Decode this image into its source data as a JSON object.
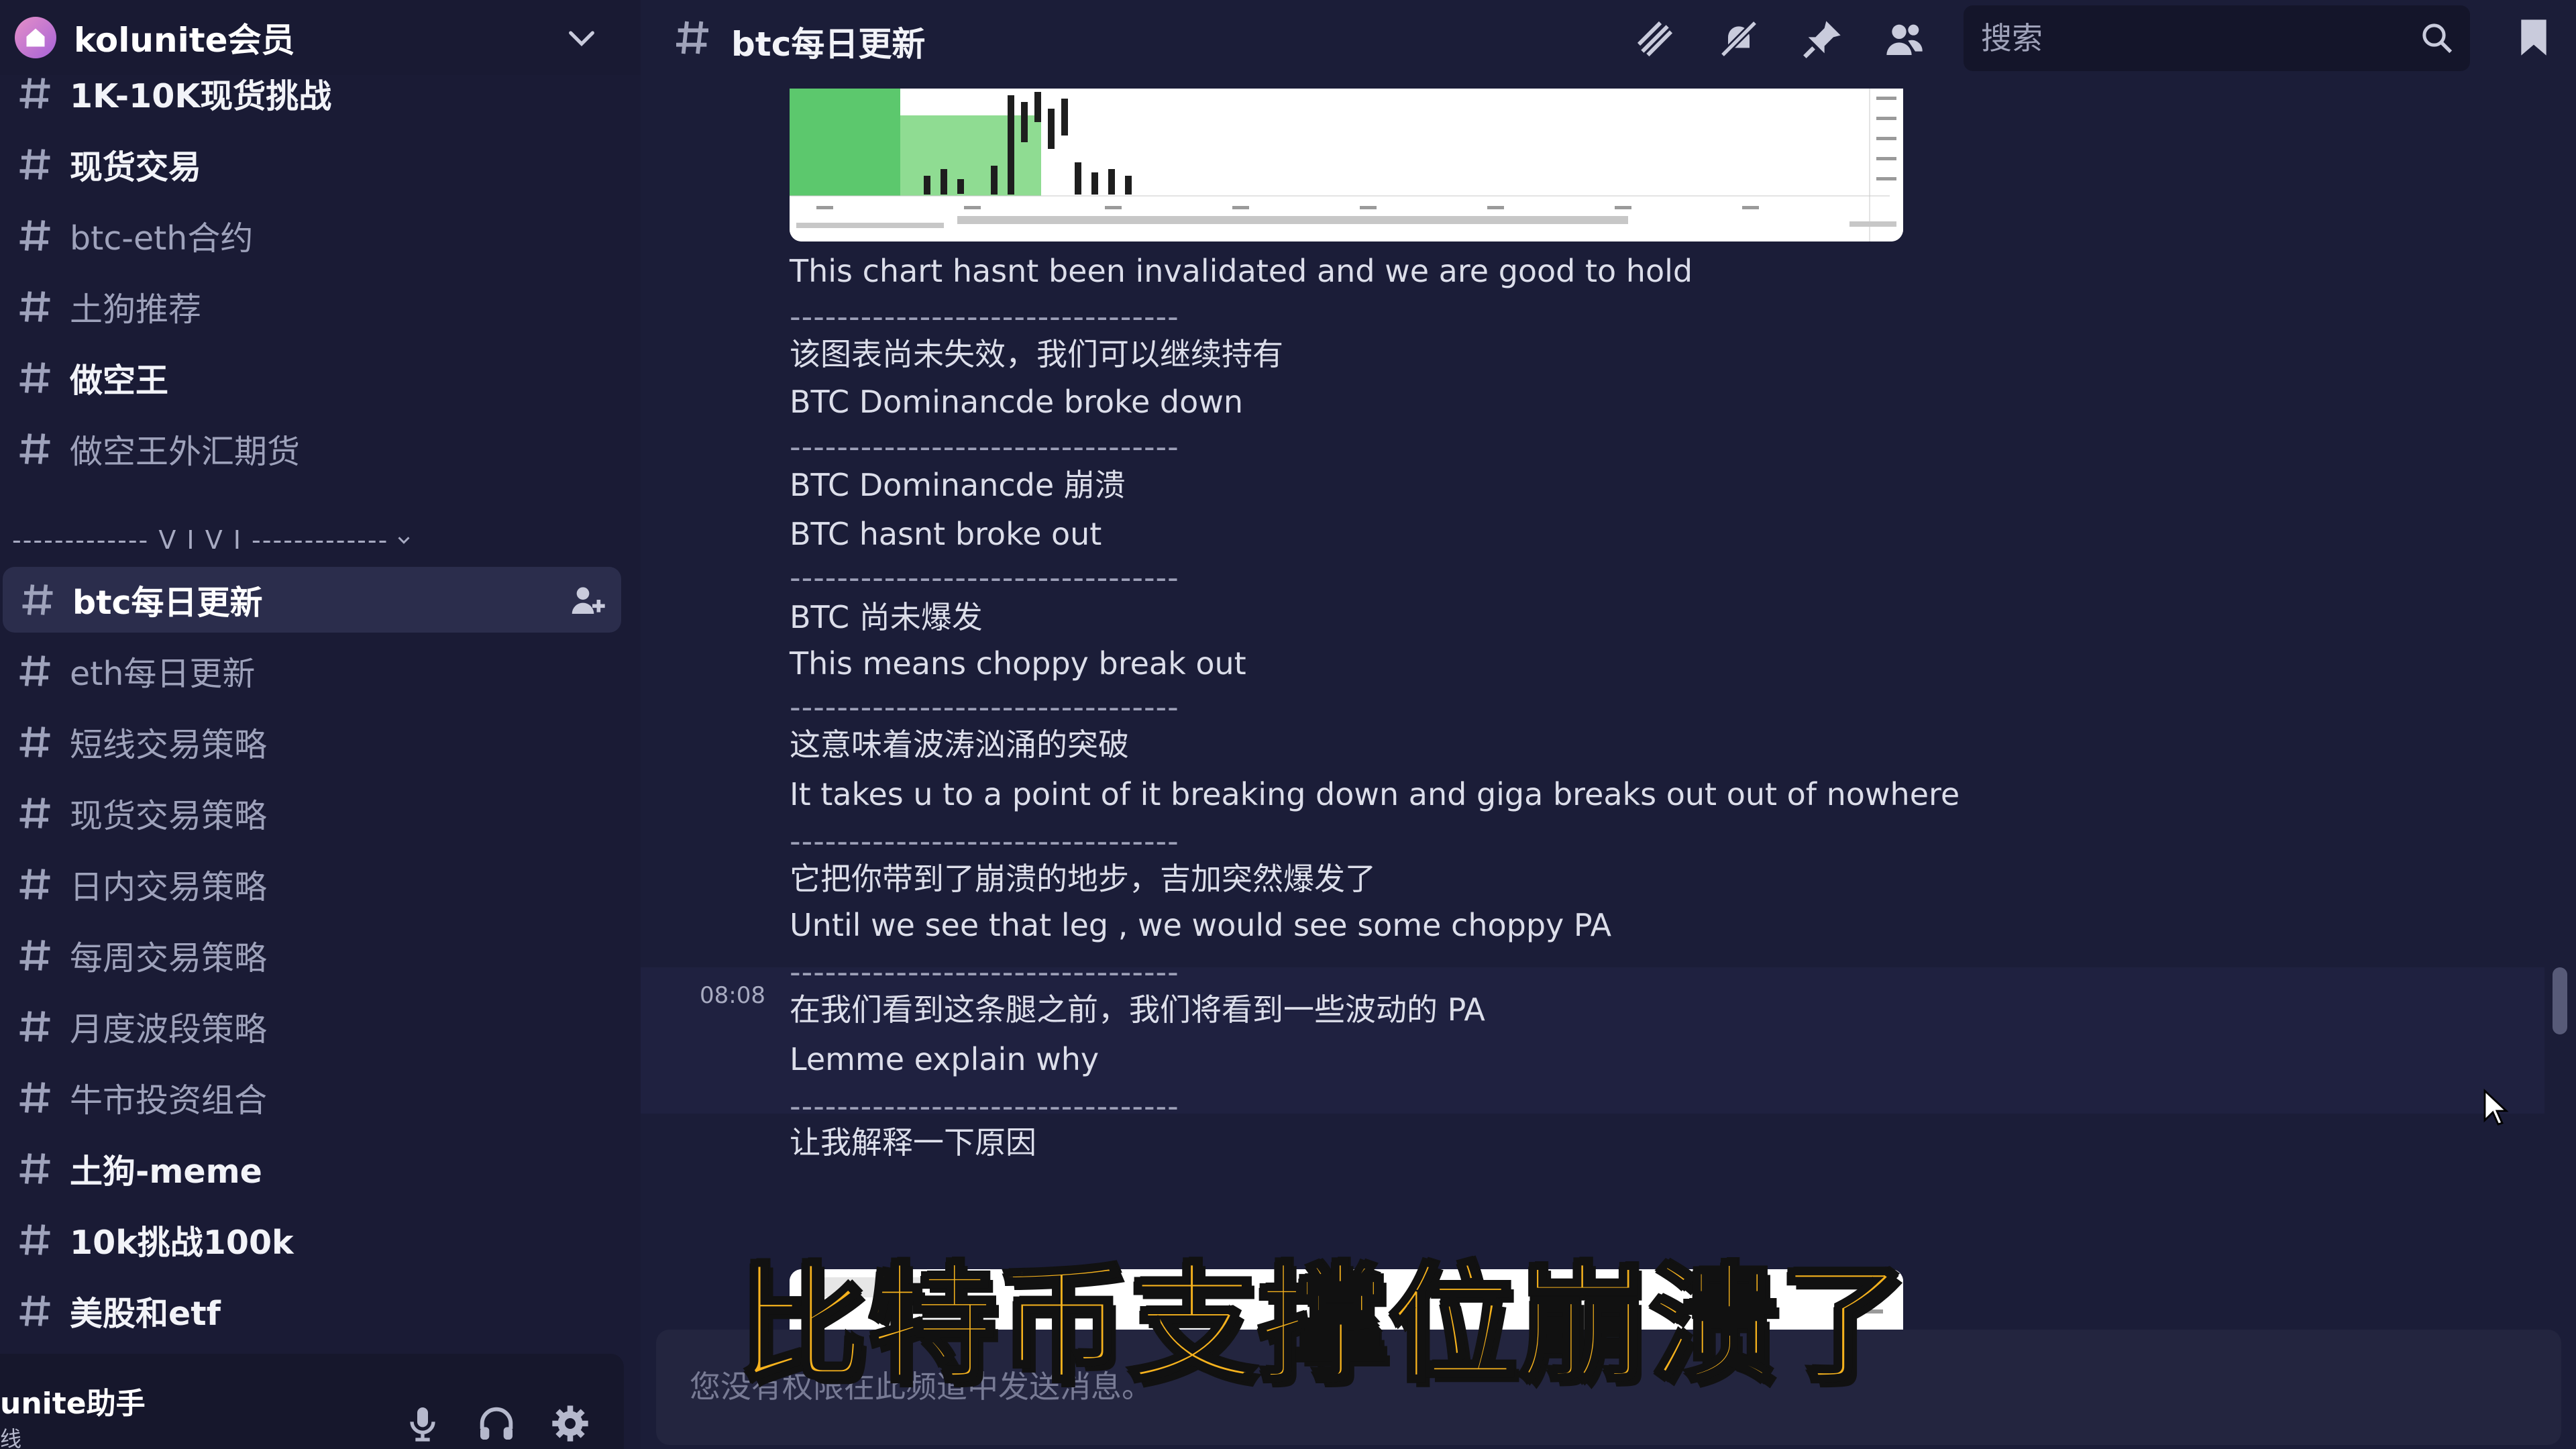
{
  "server": {
    "name": "kolunite会员"
  },
  "sidebar": {
    "channels_top": [
      {
        "label": "1K-10K现货挑战",
        "bold": true
      },
      {
        "label": "现货交易",
        "bold": true
      },
      {
        "label": "btc-eth合约",
        "bold": false
      },
      {
        "label": "土狗推荐",
        "bold": false
      },
      {
        "label": "做空王",
        "bold": true
      },
      {
        "label": "做空王外汇期货",
        "bold": false
      }
    ],
    "category": "------------- V I V I -------------",
    "channels_vivi": [
      {
        "label": "btc每日更新",
        "bold": true,
        "active": true
      },
      {
        "label": "eth每日更新",
        "bold": false
      },
      {
        "label": "短线交易策略",
        "bold": false
      },
      {
        "label": "现货交易策略",
        "bold": false
      },
      {
        "label": "日内交易策略",
        "bold": false
      },
      {
        "label": "每周交易策略",
        "bold": false
      },
      {
        "label": "月度波段策略",
        "bold": false
      },
      {
        "label": "牛市投资组合",
        "bold": false
      },
      {
        "label": "土狗-meme",
        "bold": true
      },
      {
        "label": "10k挑战100k",
        "bold": true
      },
      {
        "label": "美股和etf",
        "bold": true
      }
    ]
  },
  "user_panel": {
    "name": "unite助手",
    "status": "线"
  },
  "header": {
    "channel_name": "btc每日更新"
  },
  "search": {
    "placeholder": "搜索"
  },
  "messages": {
    "timestamp": "08:08",
    "lines": [
      {
        "text": "This chart hasnt been invalidated and we are good to hold",
        "type": "text"
      },
      {
        "text": "---------------------------------",
        "type": "dashes"
      },
      {
        "text": "该图表尚未失效，我们可以继续持有",
        "type": "text"
      },
      {
        "text": "BTC Dominancde broke down",
        "type": "text"
      },
      {
        "text": "---------------------------------",
        "type": "dashes"
      },
      {
        "text": "BTC Dominancde 崩溃",
        "type": "text"
      },
      {
        "text": "BTC hasnt broke out",
        "type": "text"
      },
      {
        "text": "---------------------------------",
        "type": "dashes"
      },
      {
        "text": "BTC 尚未爆发",
        "type": "text"
      },
      {
        "text": "This means choppy break out",
        "type": "text"
      },
      {
        "text": "---------------------------------",
        "type": "dashes"
      },
      {
        "text": "这意味着波涛汹涌的突破",
        "type": "text"
      },
      {
        "text": "It takes u to a point of it breaking down and giga breaks out out of nowhere",
        "type": "text"
      },
      {
        "text": "---------------------------------",
        "type": "dashes"
      },
      {
        "text": "它把你带到了崩溃的地步，吉加突然爆发了",
        "type": "text"
      },
      {
        "text": "Until we see that leg , we would see some choppy PA",
        "type": "text"
      },
      {
        "text": "---------------------------------",
        "type": "dashes"
      },
      {
        "text": "在我们看到这条腿之前，我们将看到一些波动的 PA",
        "type": "text"
      },
      {
        "text": "Lemme explain why",
        "type": "text"
      },
      {
        "text": "---------------------------------",
        "type": "dashes"
      },
      {
        "text": "让我解释一下原因",
        "type": "text"
      }
    ]
  },
  "composer": {
    "placeholder": "您没有权限在此频道中发送消息。"
  },
  "caption": "比特币支撑位崩溃了",
  "colors": {
    "accent_caption": "#f6b21d",
    "chart_green": "#5cc86d",
    "background": "#1b1d38"
  }
}
